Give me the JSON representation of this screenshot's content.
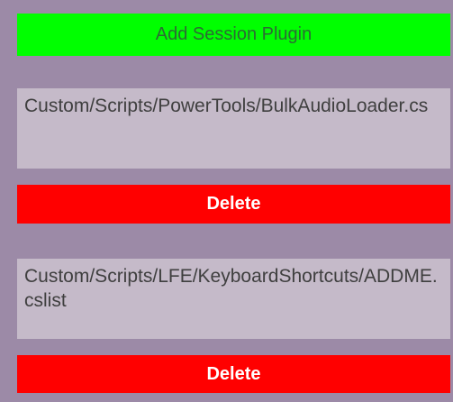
{
  "add_plugin_button": {
    "label": "Add Session Plugin"
  },
  "plugins": [
    {
      "path": "Custom/Scripts/PowerTools/BulkAudioLoader.cs",
      "delete_label": "Delete"
    },
    {
      "path": "Custom/Scripts/LFE/KeyboardShortcuts/ADDME.cslist",
      "delete_label": "Delete"
    }
  ],
  "colors": {
    "background": "#9c8aa7",
    "add_button": "#00ff00",
    "delete_button": "#ff0000",
    "path_box": "#c5bac9"
  }
}
